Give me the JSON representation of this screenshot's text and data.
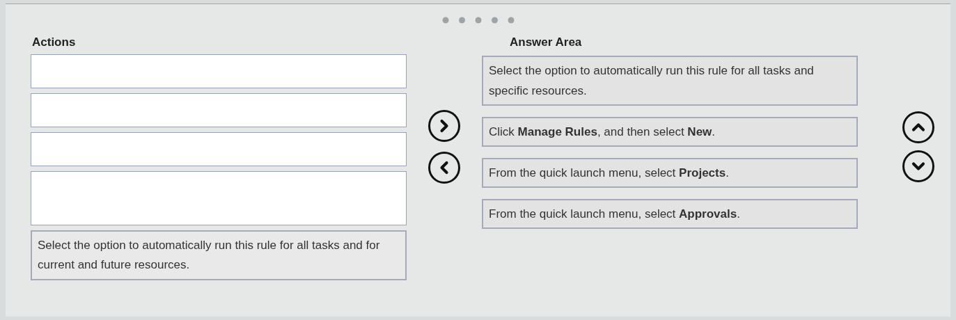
{
  "actions": {
    "title": "Actions",
    "items": [
      {
        "kind": "empty"
      },
      {
        "kind": "empty"
      },
      {
        "kind": "empty"
      },
      {
        "kind": "tall_empty"
      },
      {
        "kind": "option",
        "text": "Select the option to automatically run this rule for all tasks and for current and future resources."
      }
    ]
  },
  "answer_area": {
    "title": "Answer Area",
    "items": [
      {
        "text": "Select the option to automatically run this rule for all tasks and specific resources."
      },
      {
        "text": "Click **Manage Rules**, and then select **New**."
      },
      {
        "text": "From the quick launch menu, select **Projects**."
      },
      {
        "text": "From the quick launch menu, select **Approvals**."
      }
    ]
  }
}
